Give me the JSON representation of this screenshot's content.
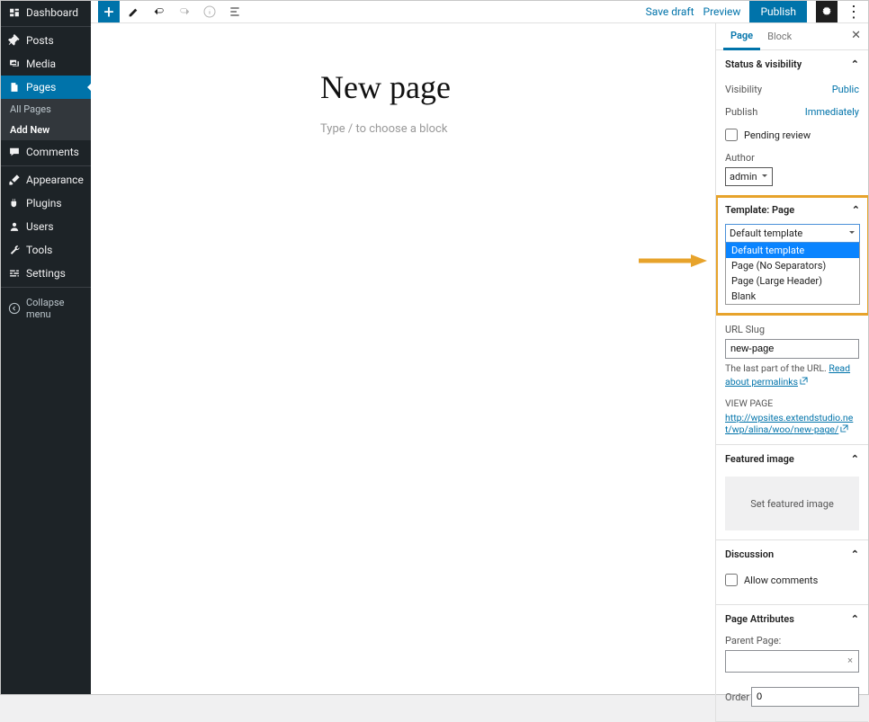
{
  "sidebar": {
    "items": [
      {
        "label": "Dashboard",
        "icon": "dashboard"
      },
      {
        "label": "Posts",
        "icon": "pin"
      },
      {
        "label": "Media",
        "icon": "media"
      },
      {
        "label": "Pages",
        "icon": "page",
        "current": true
      },
      {
        "label": "Comments",
        "icon": "comment"
      },
      {
        "label": "Appearance",
        "icon": "brush"
      },
      {
        "label": "Plugins",
        "icon": "plug"
      },
      {
        "label": "Users",
        "icon": "user"
      },
      {
        "label": "Tools",
        "icon": "wrench"
      },
      {
        "label": "Settings",
        "icon": "sliders"
      }
    ],
    "sub": {
      "all": "All Pages",
      "add": "Add New"
    },
    "collapse": "Collapse menu"
  },
  "toolbar": {
    "save_draft": "Save draft",
    "preview": "Preview",
    "publish": "Publish"
  },
  "canvas": {
    "title": "New page",
    "placeholder": "Type / to choose a block"
  },
  "settings": {
    "tabs": {
      "page": "Page",
      "block": "Block"
    },
    "status": {
      "title": "Status & visibility",
      "visibility_label": "Visibility",
      "visibility_value": "Public",
      "publish_label": "Publish",
      "publish_value": "Immediately",
      "pending": "Pending review",
      "author_label": "Author",
      "author_value": "admin"
    },
    "template": {
      "title": "Template: Page",
      "selected": "Default template",
      "options": [
        "Default template",
        "Page (No Separators)",
        "Page (Large Header)",
        "Blank"
      ]
    },
    "permalink": {
      "slug_label": "URL Slug",
      "slug_value": "new-page",
      "help_prefix": "The last part of the URL. ",
      "help_link": "Read about permalinks",
      "view_label": "VIEW PAGE",
      "url_prefix": "http://wpsites.extendstudio.net/wp/alina/woo/",
      "url_slug": "new-page/"
    },
    "featured": {
      "title": "Featured image",
      "button": "Set featured image"
    },
    "discussion": {
      "title": "Discussion",
      "allow": "Allow comments"
    },
    "attrs": {
      "title": "Page Attributes",
      "parent_label": "Parent Page:",
      "order_label": "Order",
      "order_value": "0"
    }
  }
}
